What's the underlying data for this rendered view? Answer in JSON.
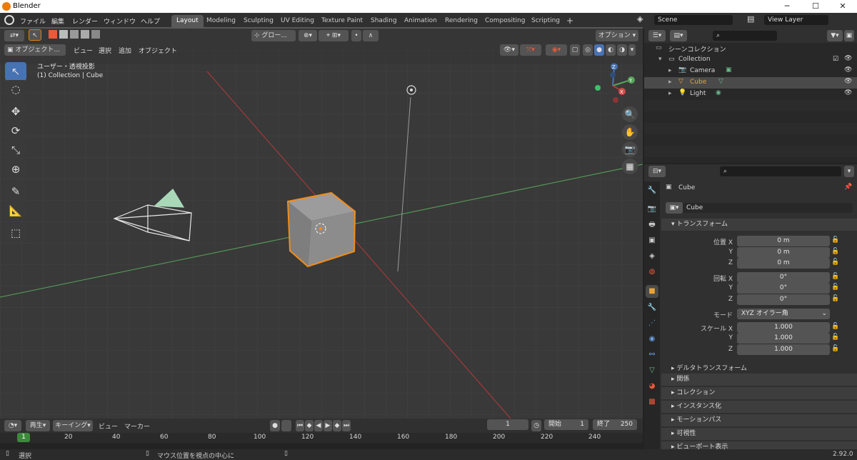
{
  "window": {
    "title": "Blender",
    "minimize": "─",
    "maximize": "☐",
    "close": "✕"
  },
  "topbar": {
    "menus": [
      "ファイル",
      "編集",
      "レンダー",
      "ウィンドウ",
      "ヘルプ"
    ],
    "workspaces": [
      "Layout",
      "Modeling",
      "Sculpting",
      "UV Editing",
      "Texture Paint",
      "Shading",
      "Animation",
      "Rendering",
      "Compositing",
      "Scripting"
    ],
    "add_tab": "+",
    "scene": "Scene",
    "view_layer": "View Layer"
  },
  "viewport": {
    "mode": "オブジェクト...",
    "menus": [
      "ビュー",
      "選択",
      "追加",
      "オブジェクト"
    ],
    "transform_orientation": "グロー...",
    "options": "オプション",
    "view_name": "ユーザー・透視投影",
    "collection_info": "(1) Collection | Cube"
  },
  "gizmo": {
    "x": "X",
    "y": "Y",
    "z": "Z"
  },
  "outliner": {
    "scene_collection": "シーンコレクション",
    "collection": "Collection",
    "items": [
      {
        "name": "Camera",
        "color": "#e0e0e0"
      },
      {
        "name": "Cube",
        "color": "#e8a33a"
      },
      {
        "name": "Light",
        "color": "#e0e0e0"
      }
    ]
  },
  "properties": {
    "object_name": "Cube",
    "object_field": "Cube",
    "transform_title": "トランスフォーム",
    "location_label": "位置 X",
    "rotation_label": "回転 X",
    "scale_label": "スケール X",
    "y": "Y",
    "z": "Z",
    "location": [
      "0 m",
      "0 m",
      "0 m"
    ],
    "rotation": [
      "0°",
      "0°",
      "0°"
    ],
    "mode_label": "モード",
    "mode_value": "XYZ オイラー角",
    "scale": [
      "1.000",
      "1.000",
      "1.000"
    ],
    "delta": "デルタトランスフォーム",
    "panels": [
      "関係",
      "コレクション",
      "インスタンス化",
      "モーションパス",
      "可視性",
      "ビューポート表示"
    ]
  },
  "timeline": {
    "playback": "再生",
    "keying": "キーイング",
    "view": "ビュー",
    "marker": "マーカー",
    "current_frame": "1",
    "start_label": "開始",
    "start": "1",
    "end_label": "終了",
    "end": "250",
    "ruler": [
      "20",
      "40",
      "60",
      "80",
      "100",
      "120",
      "140",
      "160",
      "180",
      "200",
      "220",
      "240"
    ],
    "playhead": "1"
  },
  "statusbar": {
    "select": "選択",
    "center_view": "マウス位置を視点の中心に",
    "version": "2.92.0"
  },
  "colors": {
    "accent": "#4772b3",
    "selection": "#e87d0d",
    "x_axis": "#b33a3a",
    "y_axis": "#58a35a"
  }
}
